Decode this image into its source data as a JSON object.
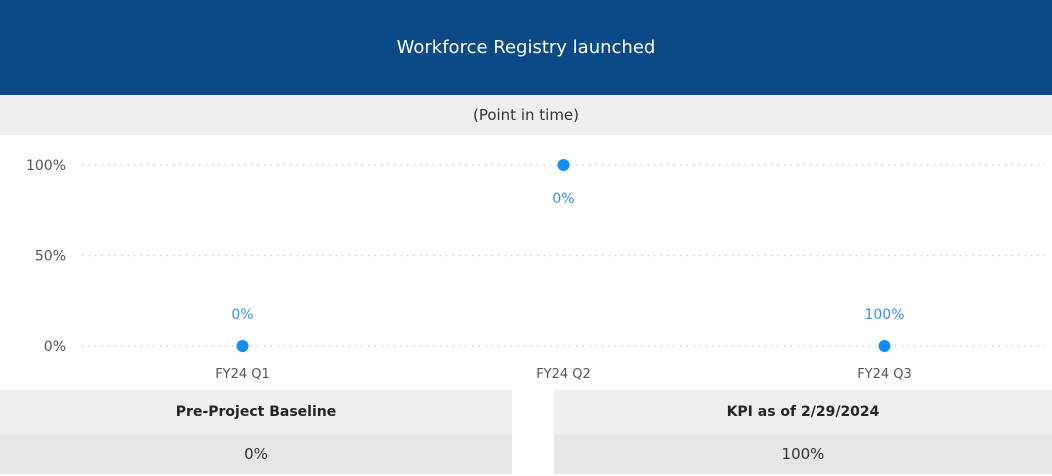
{
  "header": {
    "title": "Workforce Registry launched"
  },
  "subheader": {
    "text": "(Point in time)"
  },
  "chart_data": {
    "type": "scatter",
    "categories": [
      "FY24 Q1",
      "FY24 Q2",
      "FY24 Q3"
    ],
    "values": [
      0,
      100,
      0
    ],
    "data_labels": [
      "0%",
      "0%",
      "100%"
    ],
    "y_ticks": [
      "0%",
      "50%",
      "100%"
    ],
    "ylim": [
      0,
      100
    ],
    "grid": true,
    "color": "#118dff",
    "label_color": "#3d8ee6"
  },
  "kpis": {
    "baseline": {
      "title": "Pre-Project Baseline",
      "value": "0%"
    },
    "current": {
      "title": "KPI as of 2/29/2024",
      "value": "100%"
    }
  }
}
